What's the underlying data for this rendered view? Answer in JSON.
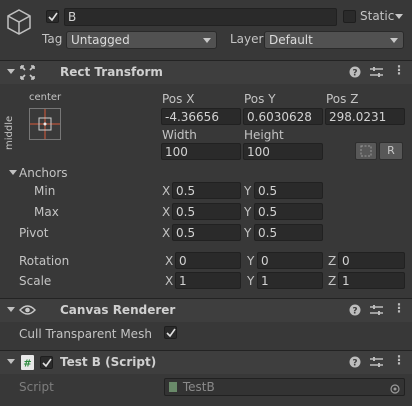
{
  "go": {
    "name": "B",
    "static_label": "Static",
    "tag_label": "Tag",
    "tag_value": "Untagged",
    "layer_label": "Layer",
    "layer_value": "Default",
    "active": true,
    "static": false
  },
  "rect": {
    "title": "Rect Transform",
    "anchor_preset_h": "center",
    "anchor_preset_v": "middle",
    "pos_x_label": "Pos X",
    "pos_y_label": "Pos Y",
    "pos_z_label": "Pos Z",
    "pos_x": "-4.36656",
    "pos_y": "0.6030628",
    "pos_z": "298.0231",
    "width_label": "Width",
    "height_label": "Height",
    "width": "100",
    "height": "100",
    "r_button": "R",
    "anchors_label": "Anchors",
    "min_label": "Min",
    "max_label": "Max",
    "min_x": "0.5",
    "min_y": "0.5",
    "max_x": "0.5",
    "max_y": "0.5",
    "pivot_label": "Pivot",
    "pivot_x": "0.5",
    "pivot_y": "0.5",
    "rotation_label": "Rotation",
    "rot_x": "0",
    "rot_y": "0",
    "rot_z": "0",
    "scale_label": "Scale",
    "scale_x": "1",
    "scale_y": "1",
    "scale_z": "1",
    "x": "X",
    "y": "Y",
    "z": "Z"
  },
  "canvas_renderer": {
    "title": "Canvas Renderer",
    "cull_label": "Cull Transparent Mesh",
    "cull_value": true
  },
  "script_comp": {
    "title": "Test B (Script)",
    "enabled": true,
    "script_label": "Script",
    "script_value": "TestB"
  },
  "colors": {
    "background": "#383838",
    "header": "#3e3e3e",
    "field": "#2a2a2a",
    "anchor_red": "#d85a3a"
  }
}
